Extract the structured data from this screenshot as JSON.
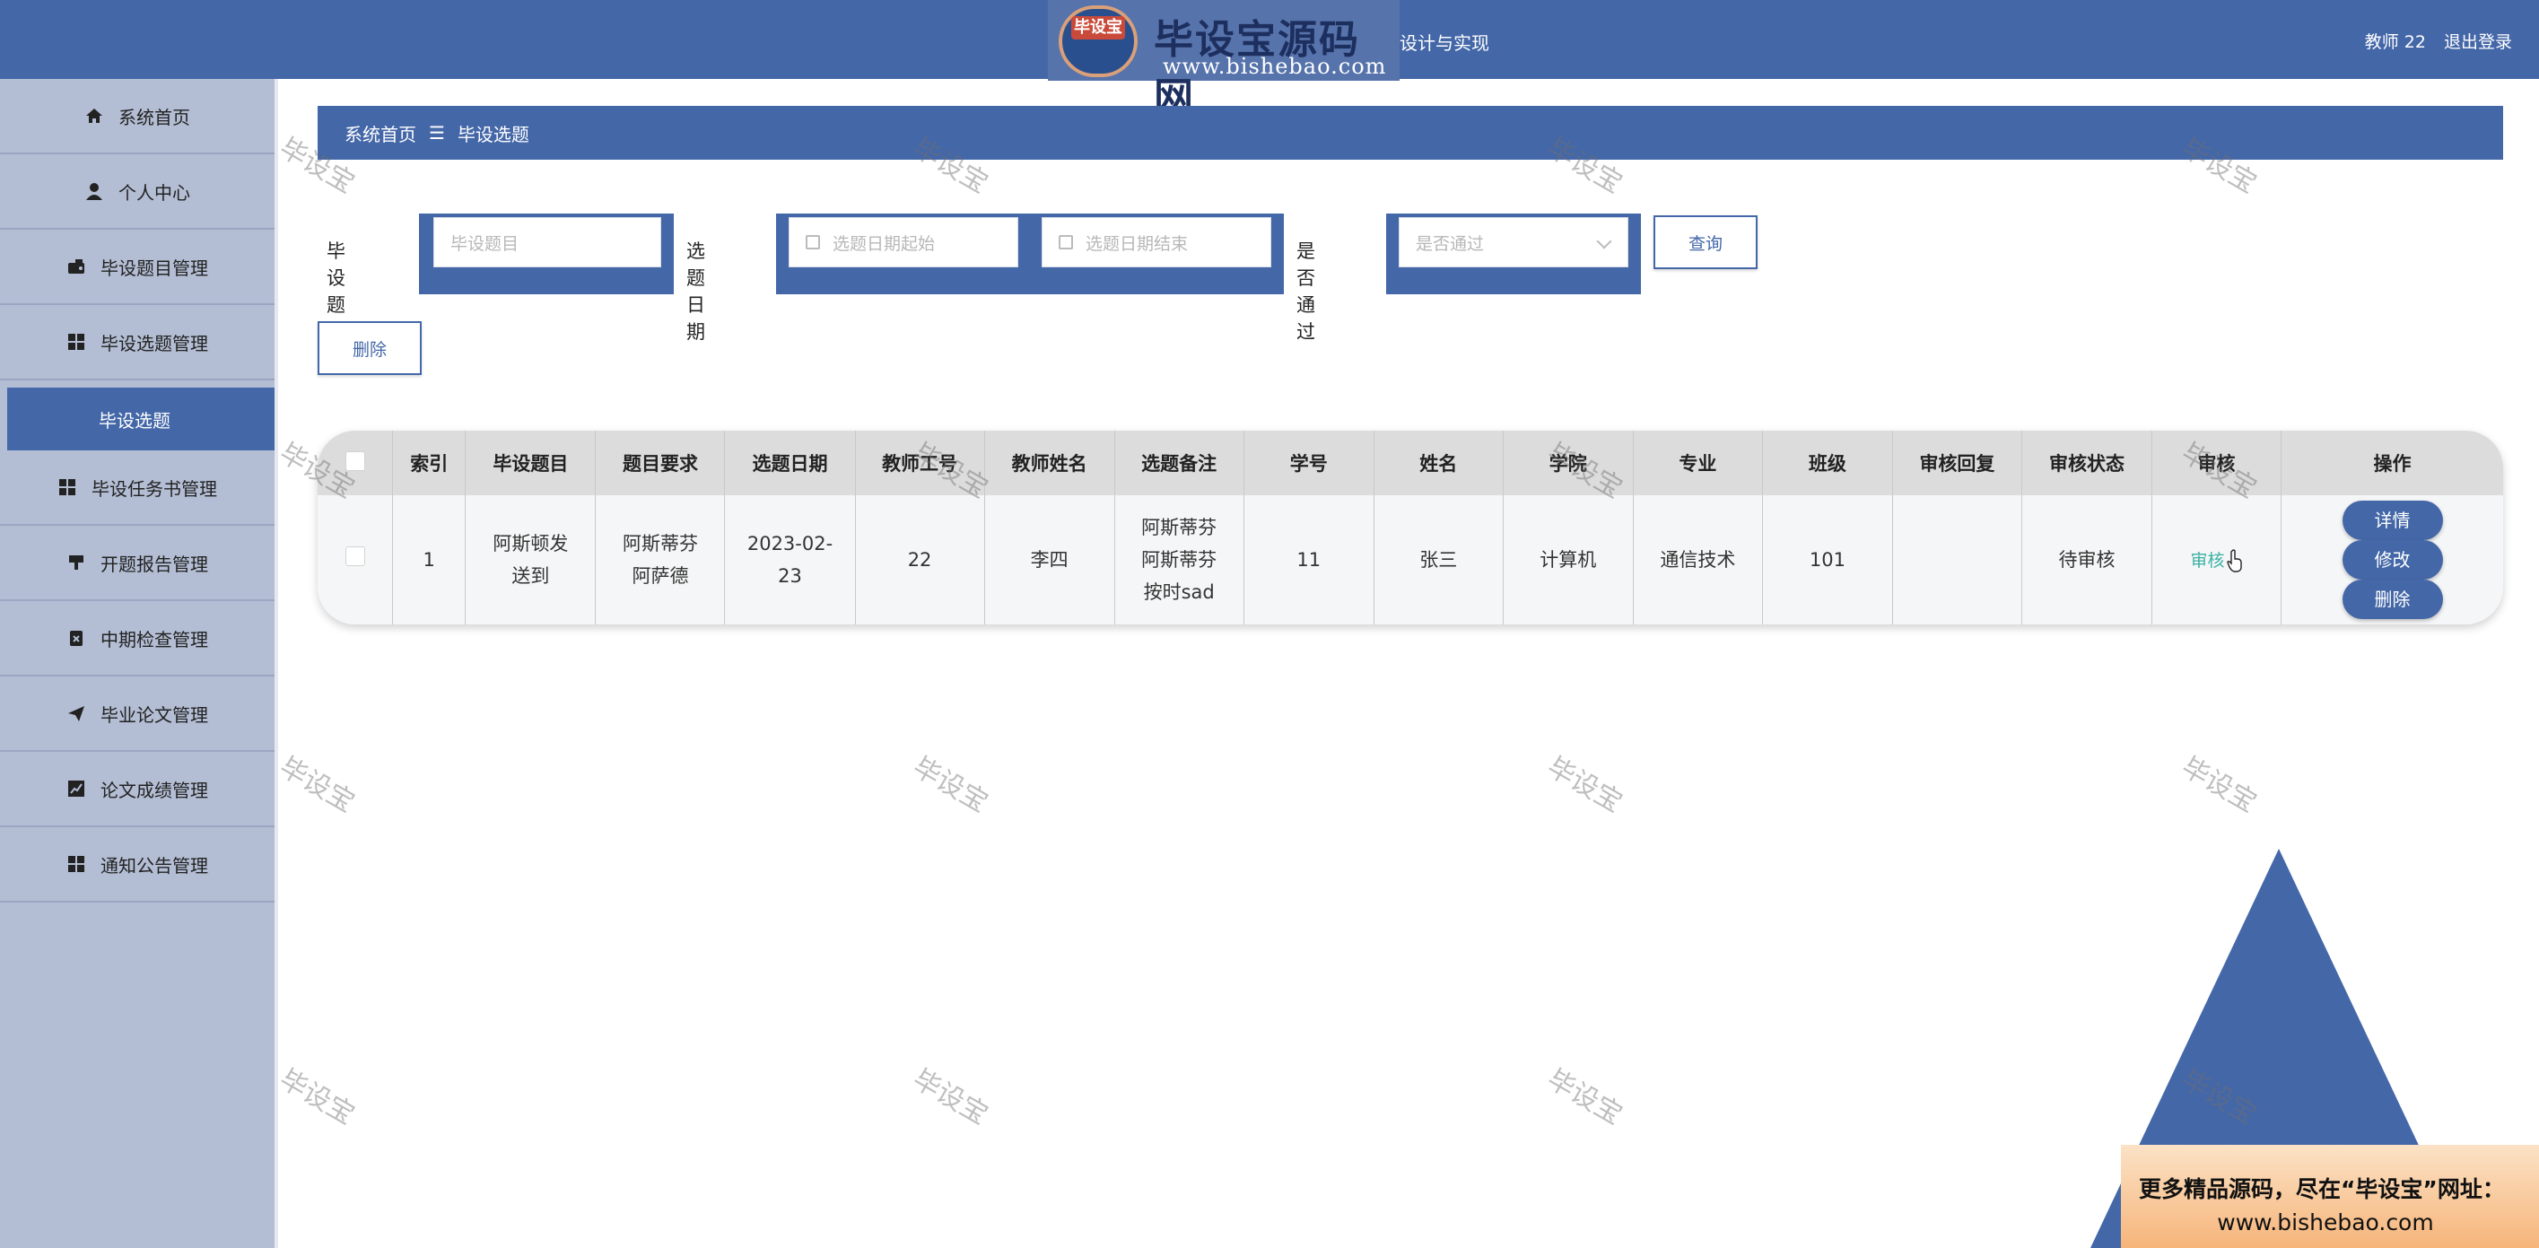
{
  "header": {
    "logo_badge": "毕设宝",
    "logo_title": "毕设宝源码网",
    "logo_url": "www.bishebao.com",
    "title_tail": "设计与实现",
    "user": "教师 22",
    "logout": "退出登录"
  },
  "sidebar": {
    "items": [
      {
        "label": "系统首页",
        "icon": "home-icon"
      },
      {
        "label": "个人中心",
        "icon": "user-icon"
      },
      {
        "label": "毕设题目管理",
        "icon": "wallet-icon"
      },
      {
        "label": "毕设选题管理",
        "icon": "grid-icon"
      },
      {
        "label": "毕设选题",
        "icon": ""
      },
      {
        "label": "毕设任务书管理",
        "icon": "grid-icon"
      },
      {
        "label": "开题报告管理",
        "icon": "stamp-icon"
      },
      {
        "label": "中期检查管理",
        "icon": "clipboard-icon"
      },
      {
        "label": "毕业论文管理",
        "icon": "send-icon"
      },
      {
        "label": "论文成绩管理",
        "icon": "chart-icon"
      },
      {
        "label": "通知公告管理",
        "icon": "grid-icon"
      }
    ]
  },
  "breadcrumb": {
    "home": "系统首页",
    "separator": "☰",
    "current": "毕设选题"
  },
  "search": {
    "topic_label": "毕设题目",
    "topic_placeholder": "毕设题目",
    "date_label": "选题日期",
    "date_start_placeholder": "选题日期起始",
    "date_end_placeholder": "选题日期结束",
    "passed_label": "是否通过",
    "passed_placeholder": "是否通过",
    "query_button": "查询"
  },
  "actions": {
    "delete_button": "删除"
  },
  "table": {
    "headers": [
      "索引",
      "毕设题目",
      "题目要求",
      "选题日期",
      "教师工号",
      "教师姓名",
      "选题备注",
      "学号",
      "姓名",
      "学院",
      "专业",
      "班级",
      "审核回复",
      "审核状态",
      "审核",
      "操作"
    ],
    "rows": [
      {
        "index": "1",
        "topic_l1": "阿斯顿发",
        "topic_l2": "送到",
        "req_l1": "阿斯蒂芬",
        "req_l2": "阿萨德",
        "date_l1": "2023-02-",
        "date_l2": "23",
        "teacher_no": "22",
        "teacher_name": "李四",
        "note_l1": "阿斯蒂芬",
        "note_l2": "阿斯蒂芬",
        "note_l3": "按时sad",
        "student_no": "11",
        "student_name": "张三",
        "college": "计算机",
        "major": "通信技术",
        "class": "101",
        "review_reply": "",
        "review_status": "待审核",
        "review_action": "审核",
        "btn_detail": "详情",
        "btn_edit": "修改",
        "btn_delete": "删除"
      }
    ]
  },
  "promo": {
    "line1": "更多精品源码，尽在“毕设宝”网址：",
    "line2": "www.bishebao.com"
  },
  "watermark": "毕设宝",
  "colors": {
    "primary": "#4467a8",
    "sidebar": "#b3bdd3",
    "link": "#3bb1a4"
  }
}
